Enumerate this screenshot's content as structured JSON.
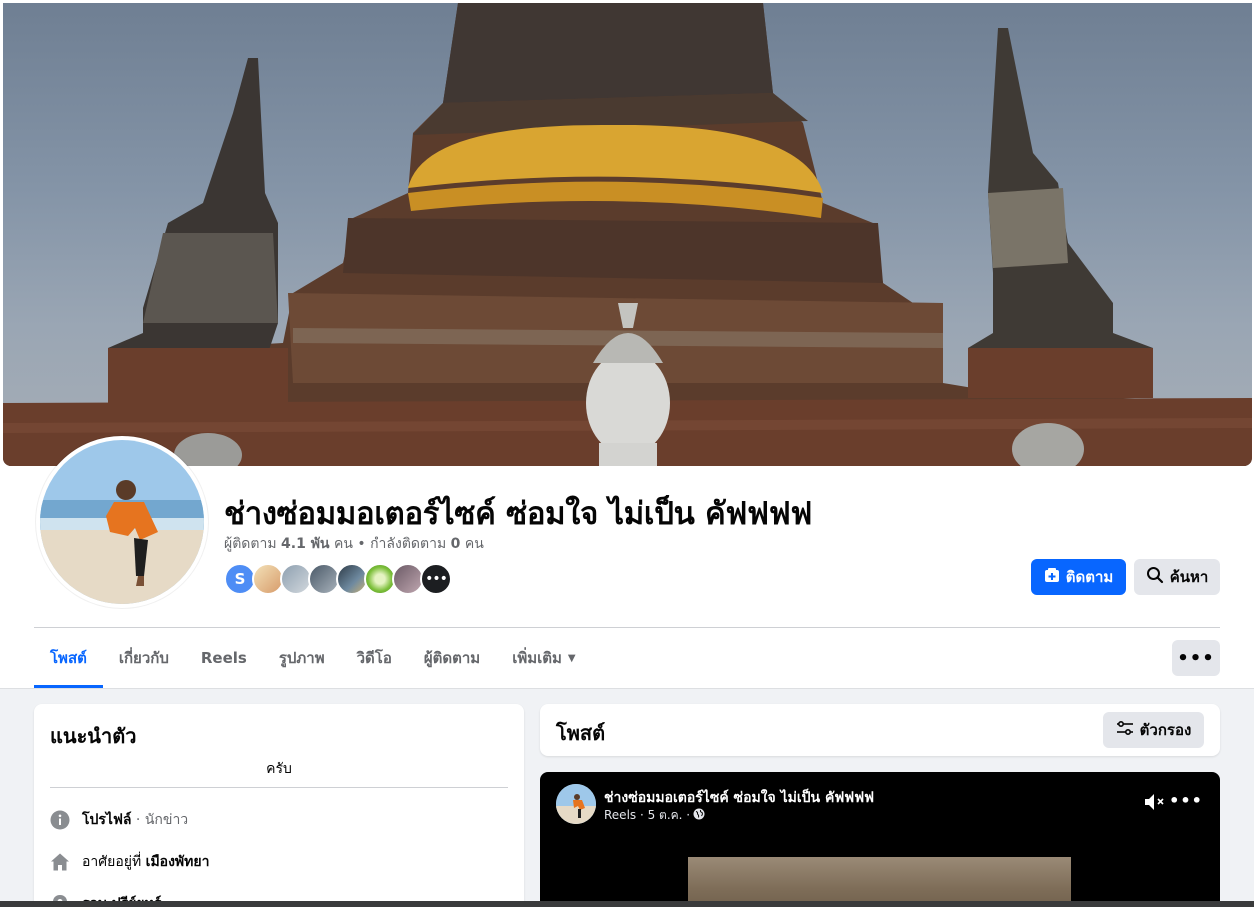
{
  "page": {
    "name": "ช่างซ่อมมอเตอร์ไซค์ ซ่อมใจ ไม่เป็น คัฟฟฟฟ",
    "followers_label": "ผู้ติดตาม",
    "followers_count": "4.1 พัน",
    "followers_unit": "คน",
    "following_text": "• กำลังติดตาม",
    "following_count": "0",
    "following_unit": "คน",
    "follower_initial": "S",
    "more_followers_glyph": "•••"
  },
  "actions": {
    "follow_label": "ติดตาม",
    "search_label": "ค้นหา"
  },
  "tabs": [
    {
      "label": "โพสต์",
      "active": true
    },
    {
      "label": "เกี่ยวกับ",
      "active": false
    },
    {
      "label": "Reels",
      "active": false
    },
    {
      "label": "รูปภาพ",
      "active": false
    },
    {
      "label": "วิดีโอ",
      "active": false
    },
    {
      "label": "ผู้ติดตาม",
      "active": false
    },
    {
      "label": "เพิ่มเติม",
      "active": false
    }
  ],
  "tab_more_glyph": "•••",
  "intro": {
    "title": "แนะนำตัว",
    "bio": "ครับ",
    "profile_label": "โปรไฟล์",
    "profile_category": "· นักข่าว",
    "lives_prefix": "อาศัยอยู่ที่",
    "lives_city": "เมืองพัทยา",
    "partial_row": "รอบ ปรีย์ยทร์"
  },
  "posts": {
    "title": "โพสต์",
    "filter_label": "ตัวกรอง"
  },
  "post": {
    "author": "ช่างซ่อมมอเตอร์ไซค์ ซ่อมใจ ไม่เป็น คัฟฟฟฟ",
    "meta": "Reels · 5 ต.ค. ·",
    "dots": "•••"
  },
  "colors": {
    "accent": "#0866ff",
    "background": "#f0f2f5",
    "button_gray": "#e4e6eb",
    "muted_text": "#65676b"
  },
  "icons": {
    "follow": "follow-page-icon",
    "search": "magnifier-icon",
    "filter": "sliders-icon",
    "info": "info-icon",
    "home": "home-icon",
    "location": "location-pin-icon",
    "mute": "speaker-muted-icon",
    "globe": "globe-icon"
  }
}
